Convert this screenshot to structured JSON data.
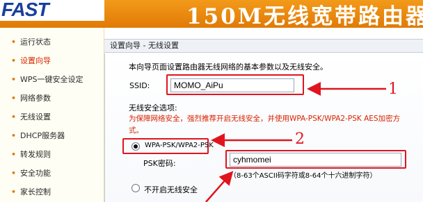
{
  "header": {
    "logo": "FAST",
    "title": "150M无线宽带路由器"
  },
  "sidebar": {
    "items": [
      {
        "label": "运行状态",
        "active": false
      },
      {
        "label": "设置向导",
        "active": true
      },
      {
        "label": "WPS一键安全设定",
        "active": false
      },
      {
        "label": "网络参数",
        "active": false
      },
      {
        "label": "无线设置",
        "active": false
      },
      {
        "label": "DHCP服务器",
        "active": false
      },
      {
        "label": "转发规则",
        "active": false
      },
      {
        "label": "安全功能",
        "active": false
      },
      {
        "label": "家长控制",
        "active": false
      }
    ]
  },
  "panel": {
    "title": "设置向导 - 无线设置",
    "intro": "本向导页面设置路由器无线网络的基本参数以及无线安全。",
    "ssid_label": "SSID:",
    "ssid_value": "MOMO_AiPu",
    "security_heading": "无线安全选项:",
    "security_warning_line1": "为保障网络安全，强烈推荐开启无线安全，并使用WPA-PSK/WPA2-PSK AES加密方",
    "security_warning_line2": "式。",
    "option_wpa_label": "WPA-PSK/WPA2-PSK",
    "option_wpa_selected": true,
    "psk_label": "PSK密码:",
    "psk_value": "cyhmomei",
    "psk_hint": "（8-63个ASCII码字符或8-64个十六进制字符）",
    "option_none_label": "不开启无线安全",
    "option_none_selected": false
  },
  "annotations": {
    "marker_1": "1",
    "marker_2": "2",
    "color": "#e0141e"
  }
}
